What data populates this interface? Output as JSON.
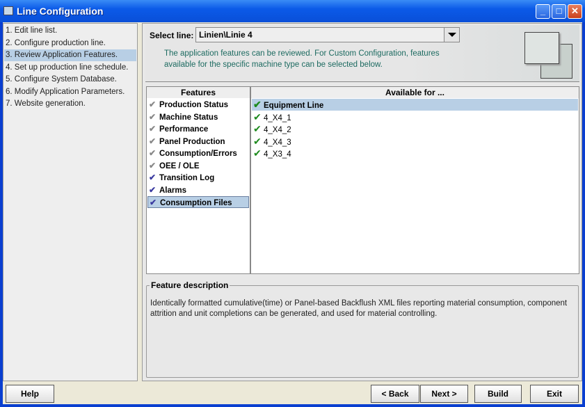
{
  "window": {
    "title": "Line Configuration"
  },
  "steps": [
    {
      "label": "1. Edit line list.",
      "selected": false
    },
    {
      "label": "2. Configure production line.",
      "selected": false
    },
    {
      "label": "3. Review Application Features.",
      "selected": true
    },
    {
      "label": "4. Set up production line schedule.",
      "selected": false
    },
    {
      "label": "5. Configure System Database.",
      "selected": false
    },
    {
      "label": "6. Modify Application Parameters.",
      "selected": false
    },
    {
      "label": "7. Website generation.",
      "selected": false
    }
  ],
  "header": {
    "select_label": "Select line:",
    "select_value": "Linien\\Linie 4",
    "info": "The application features can be reviewed. For Custom Configuration, features available for the specific machine type can be selected below."
  },
  "features": {
    "header": "Features",
    "items": [
      {
        "label": "Production Status",
        "checked": false
      },
      {
        "label": "Machine Status",
        "checked": false
      },
      {
        "label": "Performance",
        "checked": false
      },
      {
        "label": "Panel Production",
        "checked": false
      },
      {
        "label": "Consumption/Errors",
        "checked": false
      },
      {
        "label": "OEE / OLE",
        "checked": false
      },
      {
        "label": "Transition Log",
        "checked": true
      },
      {
        "label": "Alarms",
        "checked": true
      },
      {
        "label": "Consumption Files",
        "checked": true,
        "selected": true
      }
    ]
  },
  "available": {
    "header": "Available for ...",
    "items": [
      {
        "label": "Equipment Line",
        "selected": true
      },
      {
        "label": "4_X4_1"
      },
      {
        "label": "4_X4_2"
      },
      {
        "label": "4_X4_3"
      },
      {
        "label": "4_X3_4"
      }
    ]
  },
  "description": {
    "legend": "Feature description",
    "text": "Identically formatted cumulative(time) or Panel-based Backflush XML files reporting material consumption, component attrition and unit completions can be generated, and used for material controlling."
  },
  "buttons": {
    "help": "Help",
    "back": "< Back",
    "next": "Next >",
    "build": "Build",
    "exit": "Exit"
  }
}
